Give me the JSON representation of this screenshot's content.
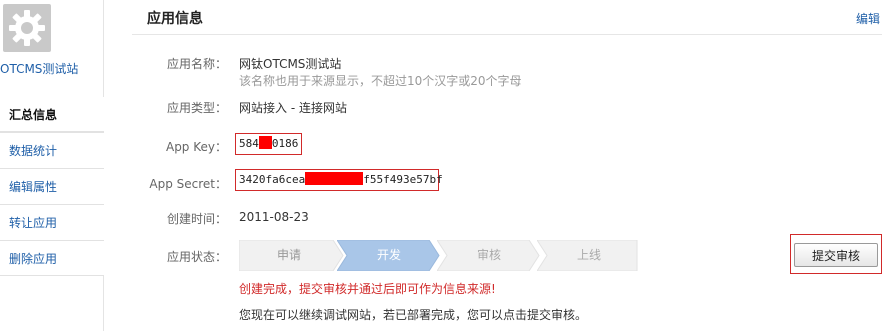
{
  "sidebar": {
    "app_name": "OTCMS测试站",
    "icon": "gear-icon",
    "items": [
      {
        "label": "汇总信息",
        "active": true
      },
      {
        "label": "数据统计",
        "active": false
      },
      {
        "label": "编辑属性",
        "active": false
      },
      {
        "label": "转让应用",
        "active": false
      },
      {
        "label": "删除应用",
        "active": false
      }
    ]
  },
  "header": {
    "title": "应用信息",
    "edit_label": "编辑"
  },
  "fields": {
    "name_label": "应用名称：",
    "name_value": "网钛OTCMS测试站",
    "name_hint": "该名称也用于来源显示，不超过10个汉字或20个字母",
    "type_label": "应用类型：",
    "type_value": "网站接入 - 连接网站",
    "appkey_label": "App Key：",
    "appkey_prefix": "584",
    "appkey_suffix": "0186",
    "secret_label": "App Secret：",
    "secret_prefix": "3420fa6cea",
    "secret_suffix": "f55f493e57bf",
    "created_label": "创建时间：",
    "created_value": "2011-08-23",
    "status_label": "应用状态："
  },
  "status": {
    "steps": [
      "申请",
      "开发",
      "审核",
      "上线"
    ],
    "current_index": 1
  },
  "actions": {
    "submit_label": "提交审核"
  },
  "messages": {
    "warning": "创建完成，提交审核并通过后即可作为信息来源!",
    "note": "您现在可以继续调试网站，若已部署完成，您可以点击提交审核。"
  },
  "colors": {
    "link": "#1f5fa8",
    "highlight_border": "#d12a2a",
    "redaction": "#ff0000",
    "active_step": "#a9c6e8",
    "inactive_step": "#f1f1f1"
  }
}
